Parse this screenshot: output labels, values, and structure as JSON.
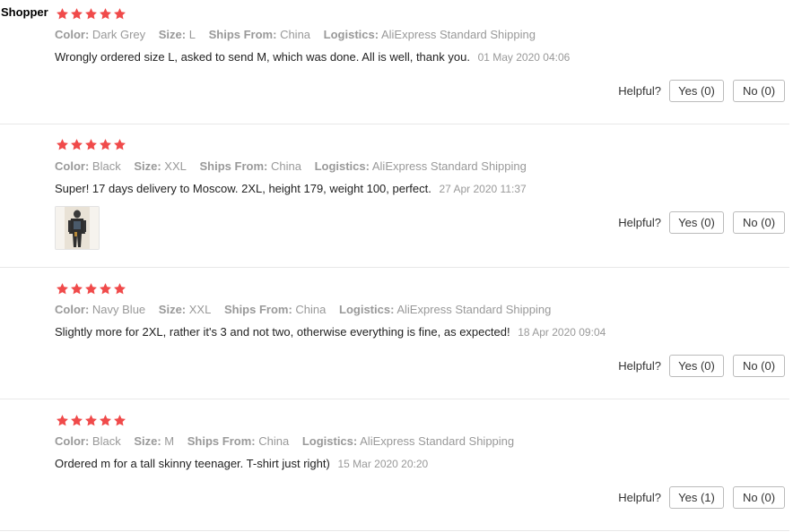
{
  "reviews": [
    {
      "author": "Shopper",
      "rating": 5,
      "attributes": [
        {
          "key": "Color:",
          "value": "Dark Grey"
        },
        {
          "key": "Size:",
          "value": "L"
        },
        {
          "key": "Ships From:",
          "value": "China"
        },
        {
          "key": "Logistics:",
          "value": "AliExpress Standard Shipping"
        }
      ],
      "text": "Wrongly ordered size L, asked to send M, which was done. All is well, thank you.",
      "date": "01 May 2020 04:06",
      "helpful_label": "Helpful?",
      "yes_label": "Yes (0)",
      "no_label": "No (0)"
    },
    {
      "author": "",
      "rating": 5,
      "attributes": [
        {
          "key": "Color:",
          "value": "Black"
        },
        {
          "key": "Size:",
          "value": "XXL"
        },
        {
          "key": "Ships From:",
          "value": "China"
        },
        {
          "key": "Logistics:",
          "value": "AliExpress Standard Shipping"
        }
      ],
      "text": "Super! 17 days delivery to Moscow. 2XL, height 179, weight 100, perfect.",
      "date": "27 Apr 2020 11:37",
      "has_photo": true,
      "helpful_label": "Helpful?",
      "yes_label": "Yes (0)",
      "no_label": "No (0)"
    },
    {
      "author": "",
      "rating": 5,
      "attributes": [
        {
          "key": "Color:",
          "value": "Navy Blue"
        },
        {
          "key": "Size:",
          "value": "XXL"
        },
        {
          "key": "Ships From:",
          "value": "China"
        },
        {
          "key": "Logistics:",
          "value": "AliExpress Standard Shipping"
        }
      ],
      "text": "Slightly more for 2XL, rather it's 3 and not two, otherwise everything is fine, as expected!",
      "date": "18 Apr 2020 09:04",
      "helpful_label": "Helpful?",
      "yes_label": "Yes (0)",
      "no_label": "No (0)"
    },
    {
      "author": "",
      "rating": 5,
      "attributes": [
        {
          "key": "Color:",
          "value": "Black"
        },
        {
          "key": "Size:",
          "value": "M"
        },
        {
          "key": "Ships From:",
          "value": "China"
        },
        {
          "key": "Logistics:",
          "value": "AliExpress Standard Shipping"
        }
      ],
      "text": "Ordered m for a tall skinny teenager. T-shirt just right)",
      "date": "15 Mar 2020 20:20",
      "helpful_label": "Helpful?",
      "yes_label": "Yes (1)",
      "no_label": "No (0)"
    }
  ],
  "colors": {
    "star": "#f04a4a",
    "muted": "#999999",
    "divider": "#e8e8e8"
  },
  "icons": {
    "star": "star-icon"
  }
}
